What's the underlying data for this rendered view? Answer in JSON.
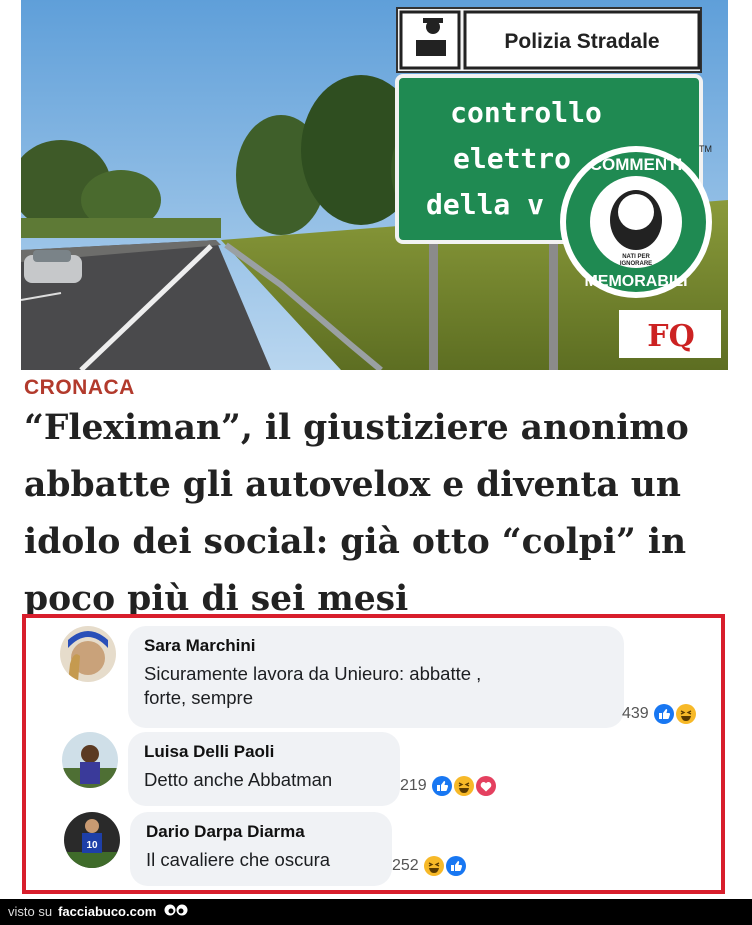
{
  "hero": {
    "sign_header": "Polizia Stradale",
    "sign_line1": "controllo",
    "sign_line2": "elettro",
    "sign_line3": "della v",
    "badge_top": "COMMENTI",
    "badge_bottom": "MEMORABILI",
    "badge_small1": "NATI PER",
    "badge_small2": "IGNORARE",
    "badge_tm": "TM",
    "logo_text": "FQ"
  },
  "article": {
    "category": "CRONACA",
    "headline": "“Fleximan”, il giustiziere anonimo abbatte gli autovelox e diventa un idolo dei social: già otto “colpi” in poco più di sei mesi"
  },
  "comments": [
    {
      "author": "Sara Marchini",
      "text_line1": "Sicuramente lavora da Unieuro: abbatte ,",
      "text_line2": "forte, sempre",
      "count": "439",
      "reactions": [
        "like",
        "haha"
      ]
    },
    {
      "author": "Luisa Delli Paoli",
      "text_line1": "Detto anche Abbatman",
      "count": "219",
      "reactions": [
        "like",
        "haha",
        "love"
      ]
    },
    {
      "author": "Dario Darpa Diarma",
      "text_line1": "Il cavaliere che oscura",
      "count": "252",
      "reactions": [
        "haha",
        "like"
      ]
    }
  ],
  "footer": {
    "prefix": "visto su",
    "brand": "facciabuco.com"
  },
  "colors": {
    "accent_red": "#d81e2c",
    "category_red": "#b23a2c",
    "sign_green": "#1f8a52",
    "like_blue": "#1877f2",
    "haha_yellow": "#f7b928",
    "love_red": "#e4405f"
  }
}
